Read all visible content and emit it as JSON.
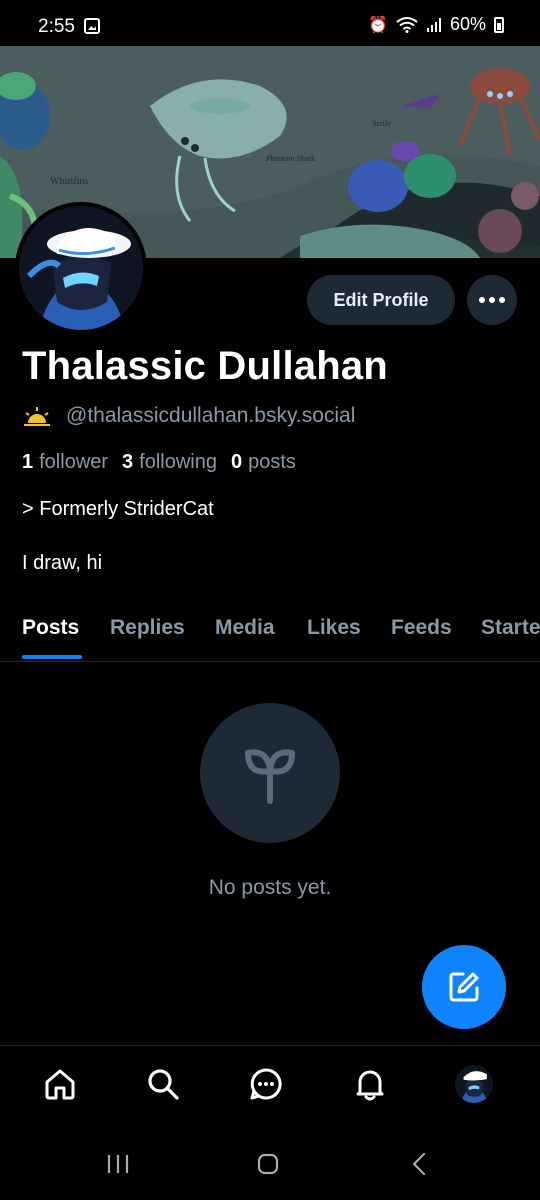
{
  "status_bar": {
    "time": "2:55",
    "battery": "60%",
    "icons": [
      "image-icon",
      "alarm-icon",
      "wifi-icon",
      "signal-icon",
      "battery-icon"
    ]
  },
  "banner": {
    "labels": [
      "Whirlfins",
      "Phantom Shark",
      "Scrife"
    ]
  },
  "profile": {
    "edit_label": "Edit Profile",
    "display_name": "Thalassic Dullahan",
    "handle": "@thalassicdullahan.bsky.social",
    "followers_count": "1",
    "followers_label": "follower",
    "following_count": "3",
    "following_label": "following",
    "posts_count": "0",
    "posts_label": "posts",
    "bio_line1": "> Formerly StriderCat",
    "bio_line2": "I draw, hi"
  },
  "tabs": [
    {
      "label": "Posts",
      "active": true
    },
    {
      "label": "Replies"
    },
    {
      "label": "Media"
    },
    {
      "label": "Likes"
    },
    {
      "label": "Feeds"
    },
    {
      "label": "Starte"
    }
  ],
  "empty_state": {
    "message": "No posts yet.",
    "icon": "sprout-icon"
  },
  "bottom_nav": [
    "home-icon",
    "search-icon",
    "chat-icon",
    "bell-icon",
    "profile-avatar"
  ],
  "colors": {
    "accent": "#1083fe",
    "button_bg": "#1e2936",
    "muted_text": "#8a98a8"
  }
}
